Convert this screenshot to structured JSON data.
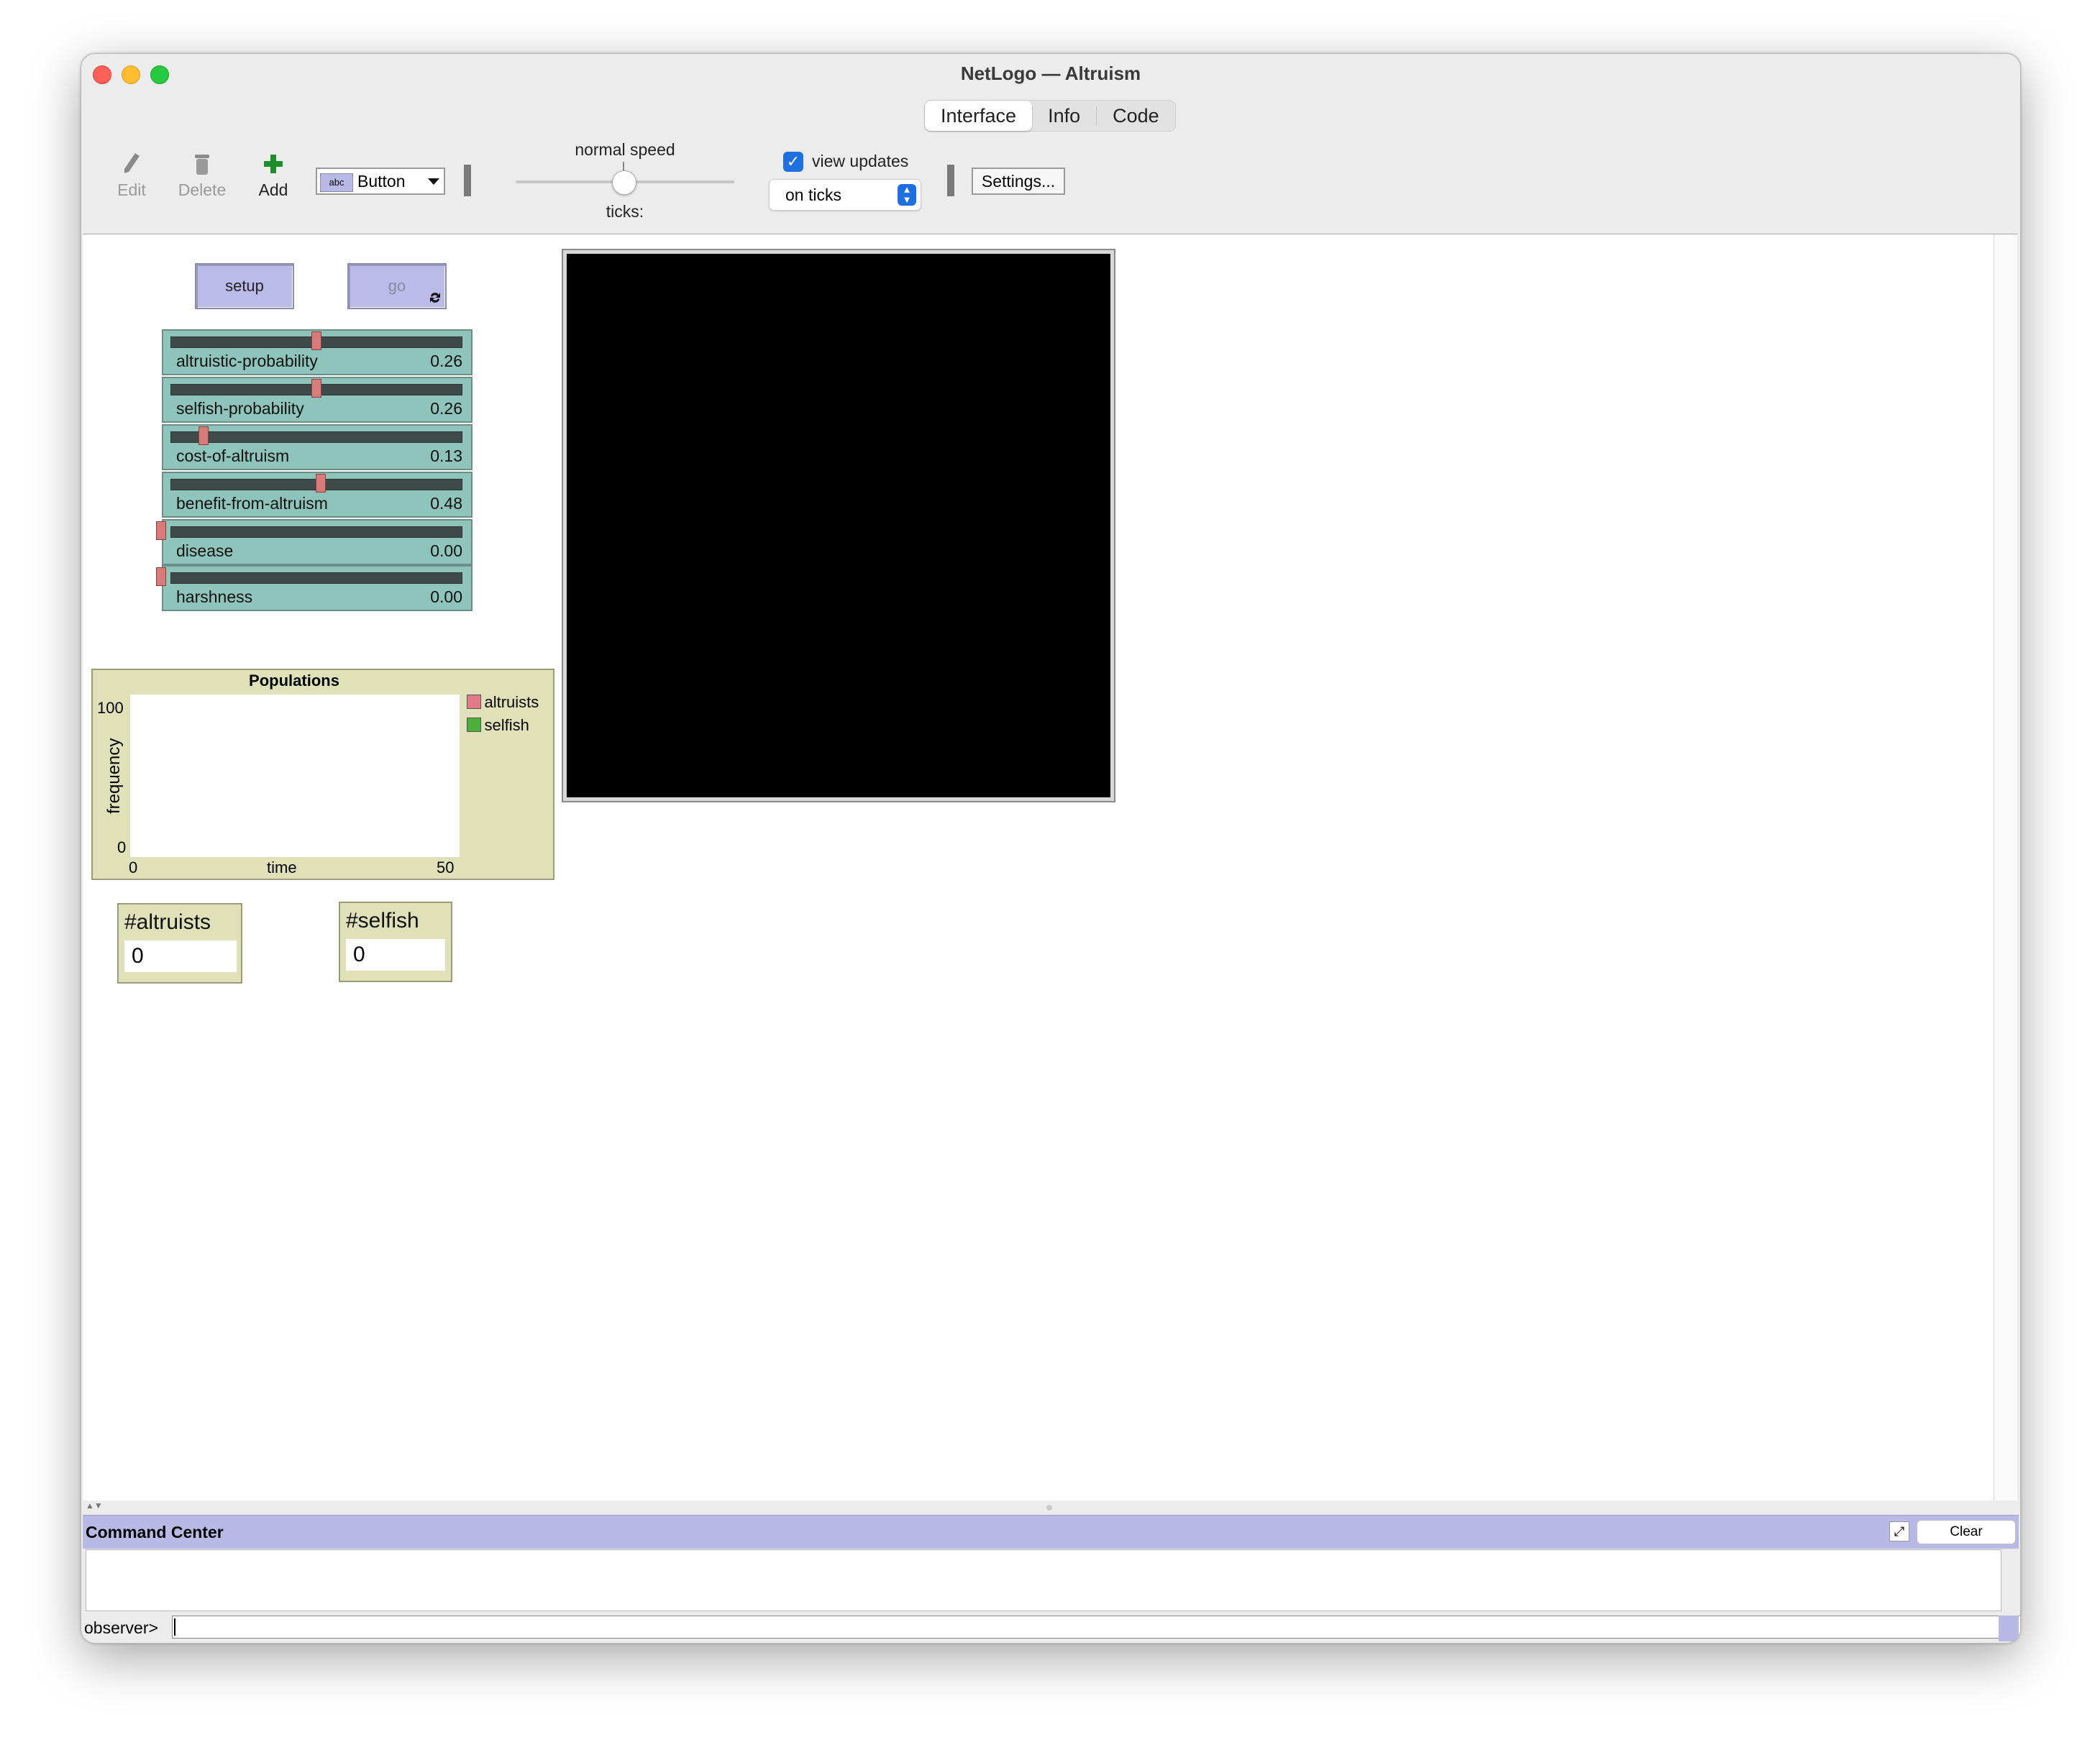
{
  "window": {
    "title": "NetLogo — Altruism"
  },
  "tabs": [
    "Interface",
    "Info",
    "Code"
  ],
  "toolbar": {
    "edit_label": "Edit",
    "delete_label": "Delete",
    "add_label": "Add",
    "widget_type": "Button",
    "widget_type_icon_text": "abc",
    "speed_label": "normal speed",
    "ticks_label": "ticks:",
    "view_updates_label": "view updates",
    "view_updates_checked": true,
    "update_mode": "on ticks",
    "settings_label": "Settings..."
  },
  "buttons": {
    "setup": "setup",
    "go": "go"
  },
  "sliders": [
    {
      "name": "altruistic-probability",
      "value": "0.26",
      "fraction": 0.52
    },
    {
      "name": "selfish-probability",
      "value": "0.26",
      "fraction": 0.52
    },
    {
      "name": "cost-of-altruism",
      "value": "0.13",
      "fraction": 0.13
    },
    {
      "name": "benefit-from-altruism",
      "value": "0.48",
      "fraction": 0.535
    },
    {
      "name": "disease",
      "value": "0.00",
      "fraction": 0.0
    },
    {
      "name": "harshness",
      "value": "0.00",
      "fraction": 0.0
    }
  ],
  "plot": {
    "title": "Populations",
    "ylabel": "frequency",
    "xlabel": "time",
    "ymax": "100",
    "ymin": "0",
    "xmin": "0",
    "xmax": "50",
    "legend": [
      {
        "name": "altruists",
        "color": "#e07a88"
      },
      {
        "name": "selfish",
        "color": "#4caf3a"
      }
    ]
  },
  "monitors": [
    {
      "label": "#altruists",
      "value": "0"
    },
    {
      "label": "#selfish",
      "value": "0"
    }
  ],
  "command_center": {
    "title": "Command Center",
    "clear_label": "Clear",
    "prompt": "observer>"
  }
}
